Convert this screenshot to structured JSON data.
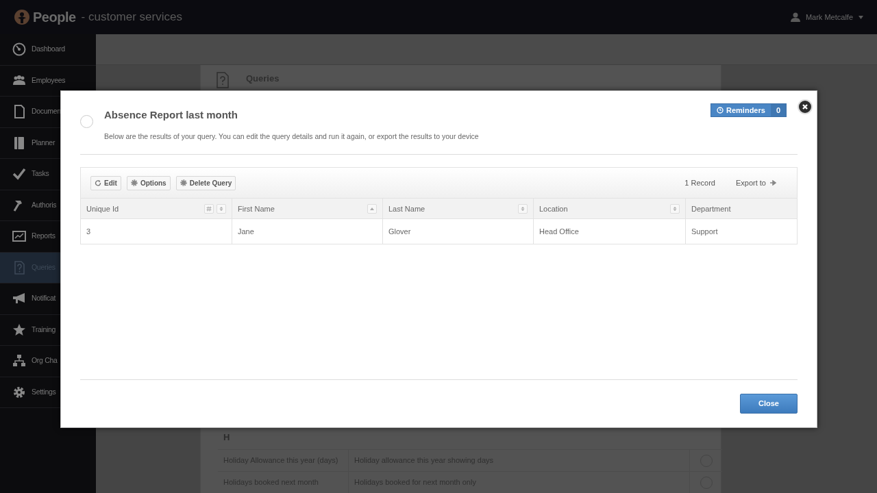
{
  "header": {
    "app_name": "People",
    "subtitle": "- customer services",
    "user": "Mark Metcalfe"
  },
  "sidebar": {
    "items": [
      {
        "label": "Dashboard",
        "selected": false
      },
      {
        "label": "Employees",
        "selected": false
      },
      {
        "label": "Documen",
        "selected": false
      },
      {
        "label": "Planner",
        "selected": false
      },
      {
        "label": "Tasks",
        "selected": false
      },
      {
        "label": "Authoris",
        "selected": false
      },
      {
        "label": "Reports",
        "selected": false
      },
      {
        "label": "Queries",
        "selected": true
      },
      {
        "label": "Notificat",
        "selected": false
      },
      {
        "label": "Training",
        "selected": false
      },
      {
        "label": "Org Cha",
        "selected": false
      },
      {
        "label": "Settings",
        "selected": false
      }
    ]
  },
  "page": {
    "title": "Queries",
    "section": "H",
    "rows": [
      {
        "name": "Holiday Allowance this year (days)",
        "description": "Holiday allowance this year showing days",
        "selected": false
      },
      {
        "name": "Holidays booked next month",
        "description": "Holidays booked for next month only",
        "selected": false
      }
    ]
  },
  "dialog": {
    "selected": false,
    "title": "Absence Report last month",
    "description": "Below are the results of your query. You can edit the query details and run it again, or export the results to your device",
    "reminders": {
      "label": "Reminders",
      "count": "0"
    },
    "toolbar": {
      "buttons": [
        "Edit",
        "Options",
        "Delete Query"
      ],
      "record_count": "1 Record",
      "export": "Export to"
    },
    "table": {
      "columns": [
        {
          "label": "Unique Id",
          "numeric": true,
          "sortable": true,
          "sorted": false
        },
        {
          "label": "First Name",
          "numeric": false,
          "sortable": true,
          "sorted": true
        },
        {
          "label": "Last Name",
          "numeric": false,
          "sortable": true,
          "sorted": false
        },
        {
          "label": "Location",
          "numeric": false,
          "sortable": true,
          "sorted": false
        },
        {
          "label": "Department",
          "numeric": false,
          "sortable": false
        }
      ],
      "rows": [
        [
          "3",
          "Jane",
          "Glover",
          "Head Office",
          "Support"
        ]
      ]
    },
    "close_button": "Close"
  }
}
